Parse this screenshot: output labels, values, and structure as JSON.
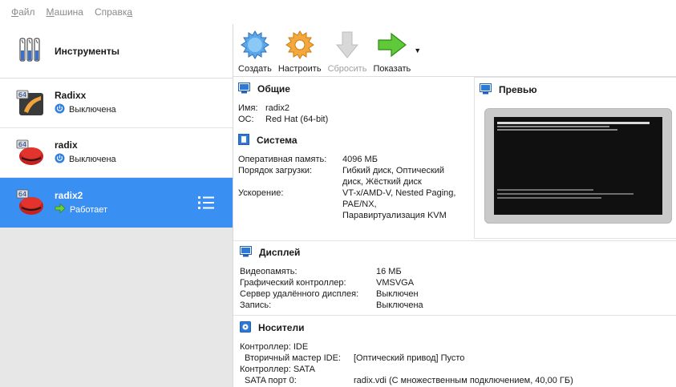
{
  "menu": [
    {
      "label": "Файл",
      "accel_prefix": "",
      "accel": "Ф",
      "rest": "айл"
    },
    {
      "label": "Машина",
      "accel_prefix": "",
      "accel": "М",
      "rest": "ашина"
    },
    {
      "label": "Справка",
      "accel_prefix": "Справк",
      "accel": "а",
      "rest": ""
    }
  ],
  "tools": {
    "label": "Инструменты",
    "icon": "tools-icon"
  },
  "vms": [
    {
      "name": "Radixx",
      "state": "Выключена",
      "state_icon": "power-off-icon",
      "badge": "64"
    },
    {
      "name": "radix",
      "state": "Выключена",
      "state_icon": "power-off-icon",
      "badge": "64"
    },
    {
      "name": "radix2",
      "state": "Работает",
      "state_icon": "running-arrow-icon",
      "badge": "64"
    }
  ],
  "toolbar": {
    "create": "Создать",
    "settings": "Настроить",
    "discard": "Сбросить",
    "show": "Показать"
  },
  "general": {
    "title": "Общие",
    "name_label": "Имя:",
    "name_value": "radix2",
    "os_label": "ОС:",
    "os_value": "Red Hat (64-bit)"
  },
  "preview": {
    "title": "Превью"
  },
  "system": {
    "title": "Система",
    "ram_label": "Оперативная память:",
    "ram_value": "4096 МБ",
    "boot_label": "Порядок загрузки:",
    "boot_value_1": "Гибкий диск, Оптический",
    "boot_value_2": "диск, Жёсткий диск",
    "accel_label": "Ускорение:",
    "accel_value_1": "VT-x/AMD-V, Nested Paging,",
    "accel_value_2": "PAE/NX,",
    "accel_value_3": "Паравиртуализация KVM"
  },
  "display": {
    "title": "Дисплей",
    "vram_label": "Видеопамять:",
    "vram_value": "16 МБ",
    "gc_label": "Графический контроллер:",
    "gc_value": "VMSVGA",
    "rds_label": "Сервер удалённого дисплея:",
    "rds_value": "Выключен",
    "rec_label": "Запись:",
    "rec_value": "Выключена"
  },
  "storage": {
    "title": "Носители",
    "ctrl_ide": "Контроллер: IDE",
    "ide_sec_label": "Вторичный мастер IDE:",
    "ide_sec_value": "[Оптический привод] Пусто",
    "ctrl_sata": "Контроллер: SATA",
    "sata0_label": "SATA порт 0:",
    "sata0_value": "radix.vdi (С множественным подключением, 40,00 ГБ)"
  },
  "colors": {
    "selection": "#3a8ff2",
    "section_icon": "#1f5fbf"
  }
}
